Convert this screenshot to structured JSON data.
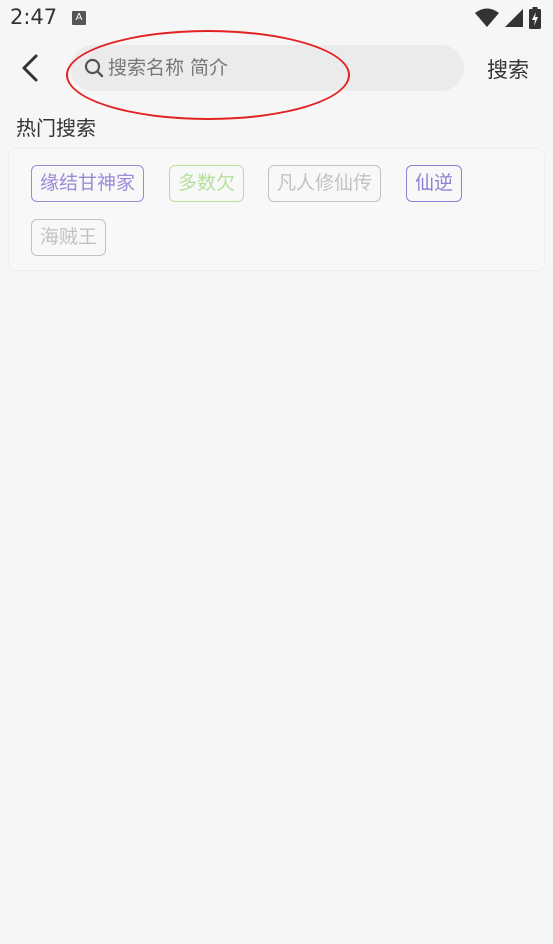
{
  "status_bar": {
    "time": "2:47",
    "app_icon_letter": "A"
  },
  "header": {
    "search_placeholder": "搜索名称 简介",
    "search_value": "",
    "search_button_label": "搜索"
  },
  "hot_search": {
    "title": "热门搜索",
    "tags": [
      {
        "label": "缘结甘神家",
        "color": "#9c8ad8"
      },
      {
        "label": "多数欠",
        "color": "#b7df9e"
      },
      {
        "label": "凡人修仙传",
        "color": "#c2c2c2"
      },
      {
        "label": "仙逆",
        "color": "#8f7fd3"
      },
      {
        "label": "海贼王",
        "color": "#c2c2c2"
      }
    ]
  },
  "colors": {
    "background": "#f6f6f6",
    "search_box": "#ebebeb",
    "annotation": "#e32222"
  }
}
